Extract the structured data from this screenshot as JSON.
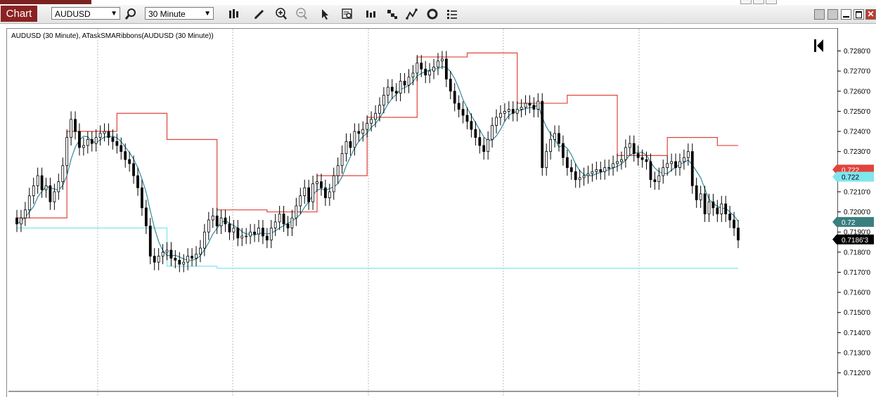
{
  "toolbar": {
    "chart_tab": "Chart",
    "instrument": "AUDUSD",
    "interval": "30 Minute",
    "icons": [
      "search-icon",
      "bar-type-icon",
      "pencil-icon",
      "zoom-in-icon",
      "zoom-out-icon",
      "pointer-icon",
      "data-box-icon",
      "bars-icon",
      "step-icon",
      "line-tool-icon",
      "refresh-icon",
      "list-icon"
    ]
  },
  "chart_label": "AUDUSD (30 Minute), ATaskSMARibbons(AUDUSD (30 Minute))",
  "colors": {
    "up": "#000000",
    "down": "#000000",
    "sma": "#2e8b9a",
    "upper_ribbon": "#e0443c",
    "lower_ribbon": "#7fe6ee",
    "tag_red": "#e0443c",
    "tag_cyan": "#7fe6ee",
    "tag_teal": "#3a7f7f",
    "tag_black": "#000000"
  },
  "price_axis": {
    "ticks": [
      "0.7280'0",
      "0.7270'0",
      "0.7260'0",
      "0.7250'0",
      "0.7240'0",
      "0.7230'0",
      "0.7220'0",
      "0.7210'0",
      "0.7200'0",
      "0.7190'0",
      "0.7180'0",
      "0.7170'0",
      "0.7160'0",
      "0.7150'0",
      "0.7140'0",
      "0.7130'0",
      "0.7120'0"
    ],
    "tags": [
      {
        "label": "0.722",
        "price": 0.7221,
        "color": "#e0443c",
        "text": "#ffffff"
      },
      {
        "label": "0.722",
        "price": 0.72175,
        "color": "#7fe6ee",
        "text": "#000000"
      },
      {
        "label": "0.72",
        "price": 0.7195,
        "color": "#3a7f7f",
        "text": "#ffffff"
      },
      {
        "label": "0.7186'3",
        "price": 0.71863,
        "color": "#000000",
        "text": "#ffffff"
      }
    ]
  },
  "chart_data": {
    "type": "candlestick",
    "ylim": [
      0.7108,
      0.7291
    ],
    "close": [
      0.7194,
      0.7197,
      0.7201,
      0.7208,
      0.7213,
      0.7218,
      0.7211,
      0.7213,
      0.7205,
      0.721,
      0.7215,
      0.7223,
      0.7237,
      0.7246,
      0.724,
      0.7232,
      0.7233,
      0.7236,
      0.7234,
      0.7237,
      0.7239,
      0.724,
      0.7237,
      0.7235,
      0.7233,
      0.723,
      0.7226,
      0.7224,
      0.7218,
      0.7212,
      0.7202,
      0.7193,
      0.7178,
      0.7175,
      0.7178,
      0.718,
      0.7181,
      0.7177,
      0.7176,
      0.7174,
      0.7175,
      0.7178,
      0.7177,
      0.7179,
      0.7182,
      0.719,
      0.7196,
      0.7198,
      0.7193,
      0.7197,
      0.7194,
      0.719,
      0.7192,
      0.7187,
      0.7188,
      0.7188,
      0.719,
      0.7189,
      0.7192,
      0.7188,
      0.7186,
      0.7192,
      0.7195,
      0.7199,
      0.7194,
      0.7192,
      0.7197,
      0.7203,
      0.7208,
      0.7212,
      0.7205,
      0.7214,
      0.7215,
      0.7212,
      0.7207,
      0.721,
      0.7218,
      0.7223,
      0.7229,
      0.7235,
      0.7232,
      0.724,
      0.7239,
      0.7241,
      0.7244,
      0.7246,
      0.7249,
      0.7253,
      0.7258,
      0.7262,
      0.726,
      0.7259,
      0.7265,
      0.7263,
      0.7267,
      0.7269,
      0.7274,
      0.7271,
      0.7268,
      0.727,
      0.7272,
      0.7275,
      0.7276,
      0.7266,
      0.726,
      0.7254,
      0.7251,
      0.7248,
      0.7245,
      0.7241,
      0.7237,
      0.7233,
      0.723,
      0.7236,
      0.7243,
      0.7247,
      0.7249,
      0.725,
      0.7251,
      0.7249,
      0.7251,
      0.7252,
      0.7254,
      0.7253,
      0.7251,
      0.7255,
      0.7222,
      0.723,
      0.7236,
      0.7239,
      0.7234,
      0.7227,
      0.7222,
      0.722,
      0.7216,
      0.7217,
      0.7218,
      0.7219,
      0.722,
      0.7221,
      0.722,
      0.7222,
      0.7222,
      0.7224,
      0.7225,
      0.7226,
      0.7232,
      0.7234,
      0.7229,
      0.7227,
      0.7226,
      0.7225,
      0.7216,
      0.7215,
      0.7218,
      0.7222,
      0.7224,
      0.7225,
      0.7222,
      0.7225,
      0.7227,
      0.723,
      0.7213,
      0.7206,
      0.7209,
      0.7199,
      0.7205,
      0.7202,
      0.7199,
      0.7204,
      0.7199,
      0.7196,
      0.7192,
      0.7186
    ]
  }
}
